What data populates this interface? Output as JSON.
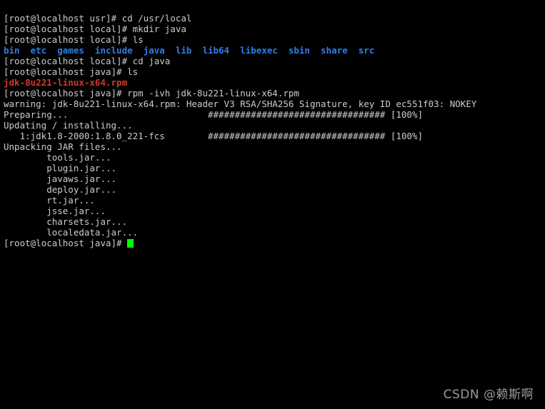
{
  "terminal": {
    "background_color": "#000000",
    "foreground_color": "#cccccc",
    "directory_color": "#2f7fe8",
    "archive_color": "#d33a2c",
    "cursor_color": "#00ff00",
    "lines": [
      {
        "id": "l01",
        "kind": "prompt",
        "text": "[root@localhost usr]# cd /usr/local"
      },
      {
        "id": "l02",
        "kind": "prompt",
        "text": "[root@localhost local]# mkdir java"
      },
      {
        "id": "l03",
        "kind": "prompt",
        "text": "[root@localhost local]# ls"
      },
      {
        "id": "l04",
        "kind": "listing",
        "text": "bin  etc  games  include  java  lib  lib64  libexec  sbin  share  src"
      },
      {
        "id": "l05",
        "kind": "prompt",
        "text": "[root@localhost local]# cd java"
      },
      {
        "id": "l06",
        "kind": "prompt",
        "text": "[root@localhost java]# ls"
      },
      {
        "id": "l07",
        "kind": "archive",
        "text": "jdk-8u221-linux-x64.rpm"
      },
      {
        "id": "l08",
        "kind": "prompt",
        "text": "[root@localhost java]# rpm -ivh jdk-8u221-linux-x64.rpm"
      },
      {
        "id": "l09",
        "kind": "output",
        "text": "warning: jdk-8u221-linux-x64.rpm: Header V3 RSA/SHA256 Signature, key ID ec551f03: NOKEY"
      },
      {
        "id": "l10",
        "kind": "output",
        "text": "Preparing...                          ################################# [100%]"
      },
      {
        "id": "l11",
        "kind": "output",
        "text": "Updating / installing..."
      },
      {
        "id": "l12",
        "kind": "output",
        "text": "   1:jdk1.8-2000:1.8.0_221-fcs        ################################# [100%]"
      },
      {
        "id": "l13",
        "kind": "output",
        "text": "Unpacking JAR files..."
      },
      {
        "id": "l14",
        "kind": "output",
        "text": "        tools.jar..."
      },
      {
        "id": "l15",
        "kind": "output",
        "text": "        plugin.jar..."
      },
      {
        "id": "l16",
        "kind": "output",
        "text": "        javaws.jar..."
      },
      {
        "id": "l17",
        "kind": "output",
        "text": "        deploy.jar..."
      },
      {
        "id": "l18",
        "kind": "output",
        "text": "        rt.jar..."
      },
      {
        "id": "l19",
        "kind": "output",
        "text": "        jsse.jar..."
      },
      {
        "id": "l20",
        "kind": "output",
        "text": "        charsets.jar..."
      },
      {
        "id": "l21",
        "kind": "output",
        "text": "        localedata.jar..."
      }
    ],
    "final_prompt": "[root@localhost java]# ",
    "ls_entries": [
      "bin",
      "etc",
      "games",
      "include",
      "java",
      "lib",
      "lib64",
      "libexec",
      "sbin",
      "share",
      "src"
    ],
    "archive_file": "jdk-8u221-linux-x64.rpm",
    "progress": {
      "bar": "#################################",
      "percent": "[100%]"
    }
  },
  "watermark": {
    "text": "CSDN @赖斯啊"
  }
}
